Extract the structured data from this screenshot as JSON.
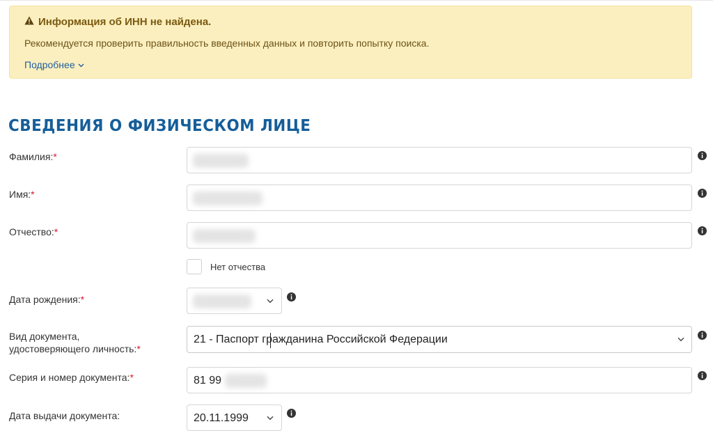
{
  "alert": {
    "title": "Информация об ИНН не найдена.",
    "text": "Рекомендуется проверить правильность введенных данных и повторить попытку поиска.",
    "more_link": "Подробнее"
  },
  "section": {
    "title": "СВЕДЕНИЯ О ФИЗИЧЕСКОМ ЛИЦЕ"
  },
  "form": {
    "lastname": {
      "label": "Фамилия:",
      "required_mark": "*"
    },
    "firstname": {
      "label": "Имя:",
      "required_mark": "*"
    },
    "patronymic": {
      "label": "Отчество:",
      "required_mark": "*"
    },
    "no_patronymic": {
      "label": "Нет отчества",
      "checked": false
    },
    "birthdate": {
      "label": "Дата рождения:",
      "required_mark": "*"
    },
    "doc_type": {
      "label_line1": "Вид документа,",
      "label_line2": "удостоверяющего личность:",
      "required_mark": "*",
      "value": "21 - Паспорт гражданина Российской Федерации"
    },
    "doc_number": {
      "label": "Серия и номер документа:",
      "required_mark": "*",
      "value": "81 99"
    },
    "doc_issue_date": {
      "label": "Дата выдачи документа:",
      "value": "20.11.1999"
    }
  },
  "colors": {
    "alert_bg": "#fcefbf",
    "alert_title": "#7a5a10",
    "link": "#1f5fa0",
    "section_title": "#155e9a",
    "required": "#d9182d",
    "info_icon": "#333333"
  }
}
